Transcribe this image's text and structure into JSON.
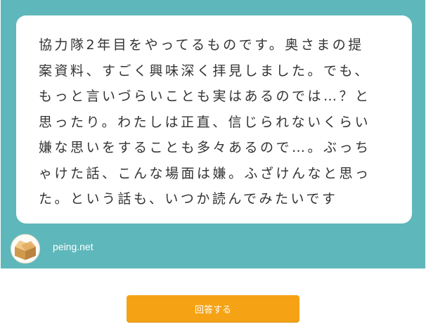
{
  "question": {
    "text": "協力隊2年目をやってるものです。奥さまの提\n案資料、すごく興味深く拝見しました。でも、\nもっと言いづらいことも実はあるのでは…？と\n思ったり。わたしは正直、信じられないくらい\n嫌な思いをすることも多々あるので…。ぶっち\nゃけた話、こんな場面は嫌。ふざけんなと思っ\nた。という話も、いつか読んでみたいです"
  },
  "footer": {
    "avatar_icon": "box-icon",
    "site_name": "peing.net"
  },
  "actions": {
    "answer_label": "回答する"
  },
  "colors": {
    "card_bg": "#5eb8bb",
    "button_bg": "#f5a315"
  }
}
